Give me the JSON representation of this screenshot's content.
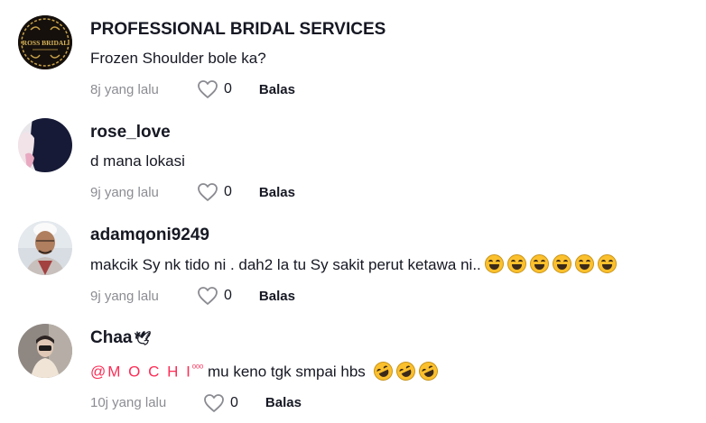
{
  "comments": [
    {
      "username": "PROFESSIONAL BRIDAL SERVICES",
      "text": "Frozen Shoulder bole ka?",
      "time": "8j yang lalu",
      "likes": "0",
      "reply": "Balas",
      "avatar_logo": "ROSS BRIDAL"
    },
    {
      "username": "rose_love",
      "text": "d mana lokasi",
      "time": "9j yang lalu",
      "likes": "0",
      "reply": "Balas"
    },
    {
      "username": "adamqoni9249",
      "text": "makcik Sy nk tido ni . dah2 la tu Sy sakit perut ketawa ni..",
      "emoji_count": 6,
      "time": "9j yang lalu",
      "likes": "0",
      "reply": "Balas"
    },
    {
      "username": "Chaa",
      "username_suffix": "🕊",
      "mention": "@M O C H I",
      "mention_suffix": "ᵒᵒᵒ",
      "text": " mu keno tgk smpai hbs ",
      "emoji_count": 3,
      "time": "10j yang lalu",
      "likes": "0",
      "reply": "Balas"
    }
  ],
  "colors": {
    "mention": "#fe2c55",
    "meta": "#8a8b91",
    "emoji": "#fbc02d"
  }
}
